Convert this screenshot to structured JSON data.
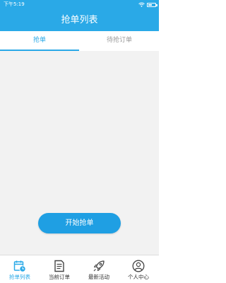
{
  "status_bar": {
    "time": "下午5:19",
    "battery_level": 0.6
  },
  "header": {
    "title": "抢单列表"
  },
  "tabs": [
    {
      "label": "抢单",
      "active": true
    },
    {
      "label": "待抢订单",
      "active": false
    }
  ],
  "main": {
    "start_button_label": "开始抢单"
  },
  "bottom_nav": [
    {
      "label": "抢单列表",
      "icon": "calendar-clock-icon",
      "active": true
    },
    {
      "label": "当前订单",
      "icon": "document-list-icon",
      "active": false
    },
    {
      "label": "最新活动",
      "icon": "rocket-icon",
      "active": false
    },
    {
      "label": "个人中心",
      "icon": "person-icon",
      "active": false
    }
  ],
  "colors": {
    "accent": "#2aa9e7",
    "inactive_text": "#9a9a9a",
    "background": "#f2f2f2"
  }
}
